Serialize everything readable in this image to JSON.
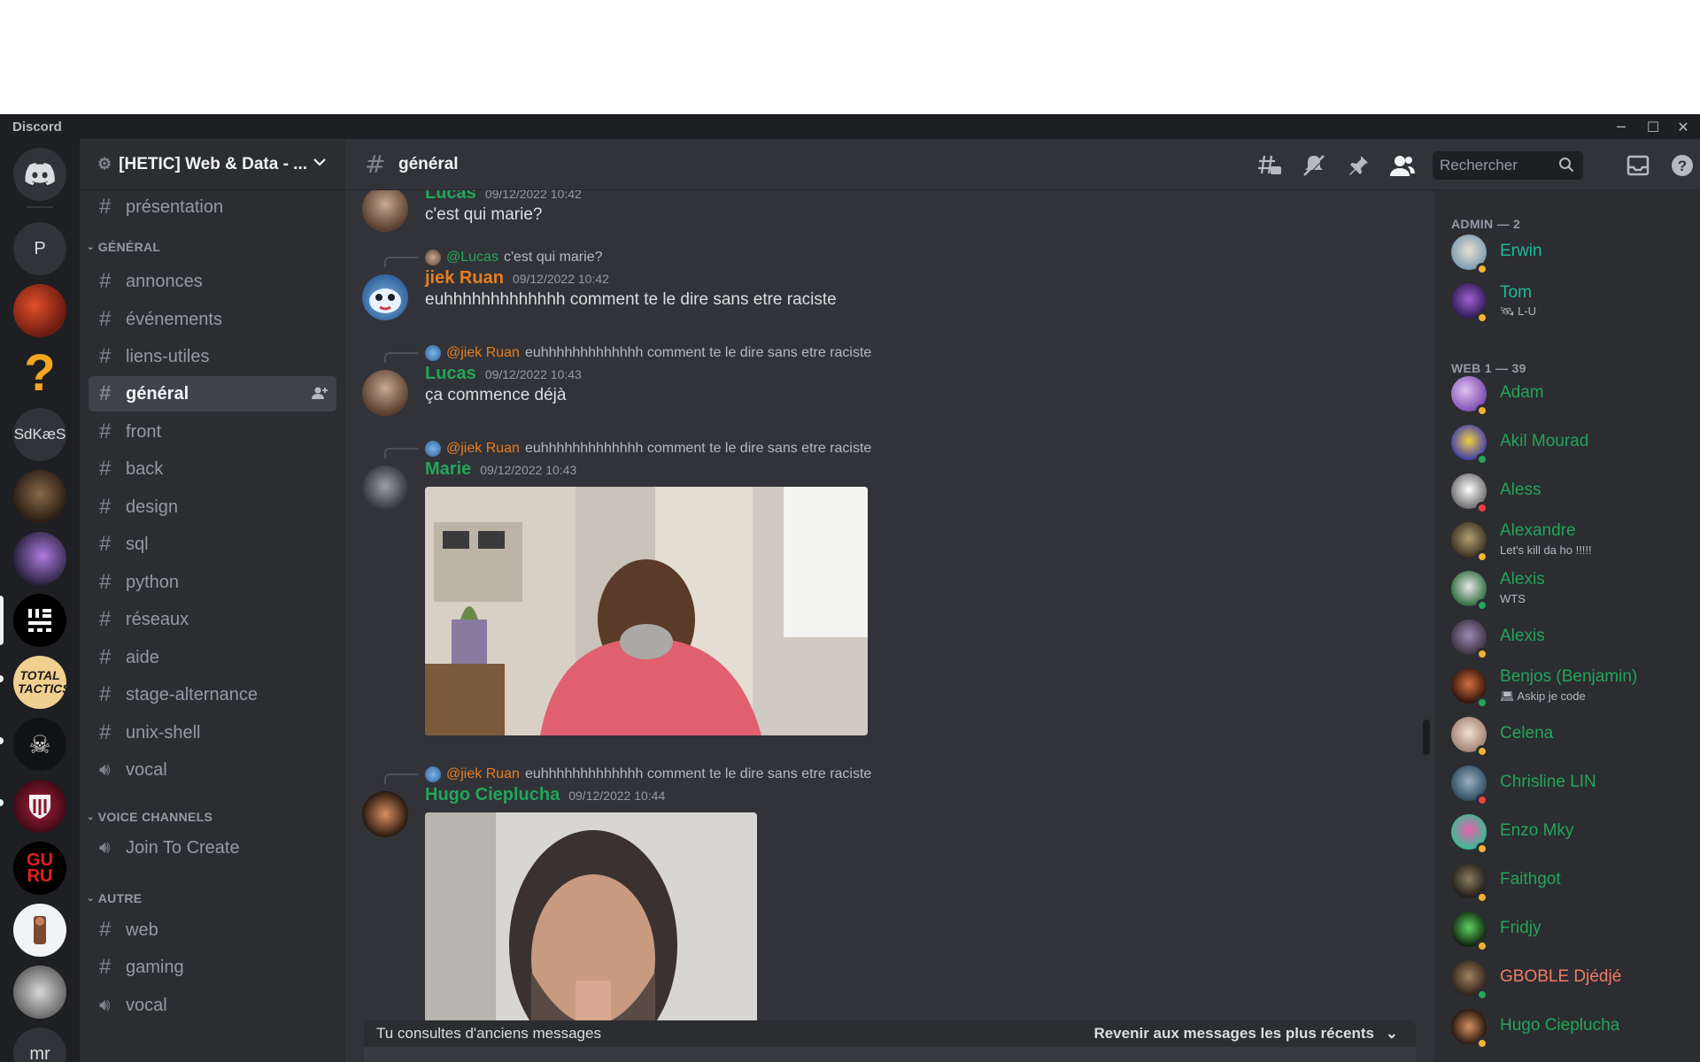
{
  "window": {
    "app_name": "Discord"
  },
  "server": {
    "name": "[HETIC] Web & Data - ..."
  },
  "rail": {
    "servers": [
      {
        "label": "",
        "icon": "discord-home-icon"
      },
      {
        "label": "P"
      },
      {
        "label": "",
        "icon": "red-dragon"
      },
      {
        "label": "?",
        "icon": "question-icon"
      },
      {
        "label": "SdKæS"
      },
      {
        "label": "",
        "icon": "dark-creature"
      },
      {
        "label": "",
        "icon": "purple-creature"
      },
      {
        "label": "",
        "icon": "glyph-logo"
      },
      {
        "label": "TOTAL TACTICS"
      },
      {
        "label": "",
        "icon": "skull-icon"
      },
      {
        "label": "",
        "icon": "shield-logo"
      },
      {
        "label": "GU RU"
      },
      {
        "label": "",
        "icon": "portrait"
      },
      {
        "label": "",
        "icon": "storm-creature"
      },
      {
        "label": "mr"
      }
    ]
  },
  "channels": {
    "top": [
      {
        "name": "présentation"
      }
    ],
    "general_label": "GÉNÉRAL",
    "general": [
      {
        "name": "annonces"
      },
      {
        "name": "événements"
      },
      {
        "name": "liens-utiles"
      },
      {
        "name": "général"
      },
      {
        "name": "front"
      },
      {
        "name": "back"
      },
      {
        "name": "design"
      },
      {
        "name": "sql"
      },
      {
        "name": "python"
      },
      {
        "name": "réseaux"
      },
      {
        "name": "aide"
      },
      {
        "name": "stage-alternance"
      },
      {
        "name": "unix-shell"
      },
      {
        "name": "vocal"
      }
    ],
    "voice_label": "VOICE CHANNELS",
    "voice": [
      {
        "name": "Join To Create"
      }
    ],
    "autre_label": "AUTRE",
    "autre": [
      {
        "name": "web"
      },
      {
        "name": "gaming"
      },
      {
        "name": "vocal"
      }
    ]
  },
  "header": {
    "channel": "général",
    "search_placeholder": "Rechercher"
  },
  "messages": [
    {
      "author": "Lucas",
      "time": "09/12/2022 10:42",
      "text": "c'est qui marie?"
    },
    {
      "reply_to": "@Lucas",
      "reply_text": "c'est qui marie?",
      "author": "jiek Ruan",
      "time": "09/12/2022 10:42",
      "text": "euhhhhhhhhhhhhh comment te le dire sans etre raciste"
    },
    {
      "reply_to": "@jiek Ruan",
      "reply_text": "euhhhhhhhhhhhhh comment te le dire sans etre raciste",
      "author": "Lucas",
      "time": "09/12/2022 10:43",
      "text": "ça commence déjà"
    },
    {
      "reply_to": "@jiek Ruan",
      "reply_text": "euhhhhhhhhhhhhh comment te le dire sans etre raciste",
      "author": "Marie",
      "time": "09/12/2022 10:43",
      "text": ""
    },
    {
      "reply_to": "@jiek Ruan",
      "reply_text": "euhhhhhhhhhhhhh comment te le dire sans etre raciste",
      "author": "Hugo Cieplucha",
      "time": "09/12/2022 10:44",
      "text": ""
    }
  ],
  "old_messages_bar": {
    "text": "Tu consultes d'anciens messages",
    "action": "Revenir aux messages les plus récents"
  },
  "members": {
    "admin_label": "ADMIN — 2",
    "admin": [
      {
        "name": "Erwin",
        "status": "idle"
      },
      {
        "name": "Tom",
        "sub": "L-U",
        "status": "idle"
      }
    ],
    "web_label": "WEB 1 — 39",
    "web": [
      {
        "name": "Adam",
        "status": "idle"
      },
      {
        "name": "Akil Mourad",
        "status": "online"
      },
      {
        "name": "Aless",
        "status": "dnd"
      },
      {
        "name": "Alexandre",
        "sub": "Let's kill da ho !!!!!",
        "status": "idle"
      },
      {
        "name": "Alexis",
        "sub": "WTS",
        "status": "online"
      },
      {
        "name": "Alexis",
        "status": "idle"
      },
      {
        "name": "Benjos (Benjamin)",
        "sub": "Askip je code",
        "status": "online"
      },
      {
        "name": "Celena",
        "status": "idle"
      },
      {
        "name": "Chrisline LIN",
        "status": "dnd"
      },
      {
        "name": "Enzo Mky",
        "status": "idle"
      },
      {
        "name": "Faithgot",
        "status": "idle"
      },
      {
        "name": "Fridjy",
        "status": "idle"
      },
      {
        "name": "GBOBLE Djédjé",
        "status": "online"
      },
      {
        "name": "Hugo Cieplucha",
        "status": "idle"
      }
    ]
  },
  "colors": {
    "green_name": "#23a55a",
    "orange_name": "#e67e22",
    "cyan_name": "#1abc9c",
    "pink_name": "#f47b67",
    "idle": "#f0b232",
    "online": "#23a55a",
    "dnd": "#f23f43"
  }
}
